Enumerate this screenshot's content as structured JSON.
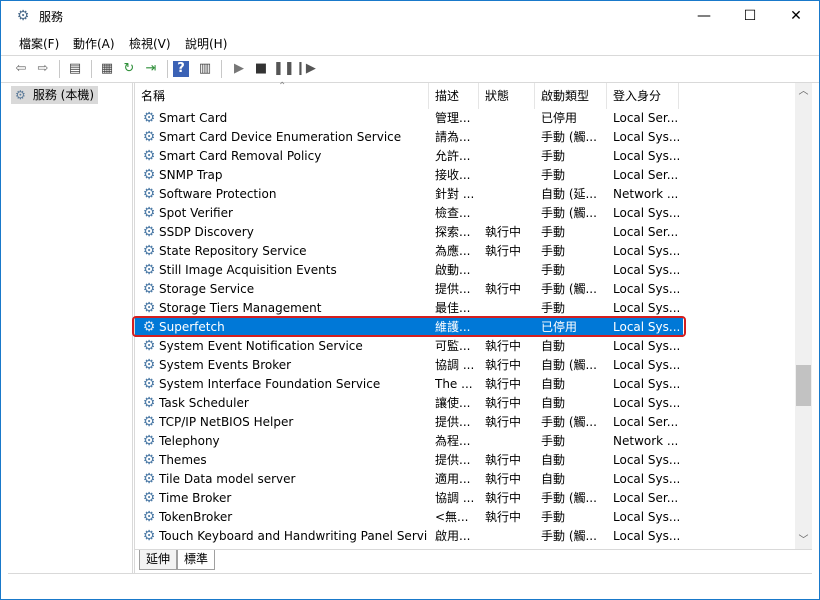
{
  "window": {
    "title": "服務",
    "controls": {
      "minimize": "—",
      "maximize": "☐",
      "close": "✕"
    }
  },
  "menu": [
    {
      "label": "檔案(F)"
    },
    {
      "label": "動作(A)"
    },
    {
      "label": "檢視(V)"
    },
    {
      "label": "說明(H)"
    }
  ],
  "toolbar": {
    "icons": [
      "back-icon",
      "forward-icon",
      "show-console-tree-icon",
      "properties-icon",
      "refresh-icon",
      "export-list-icon",
      "help-icon",
      "view-icon",
      "start-icon",
      "stop-icon",
      "pause-icon",
      "restart-icon"
    ]
  },
  "tree": {
    "item": "服務 (本機)"
  },
  "columns": {
    "name": "名稱",
    "description": "描述",
    "status": "狀態",
    "startup": "啟動類型",
    "logon": "登入身分"
  },
  "services": [
    {
      "name": "Smart Card",
      "description": "管理...",
      "status": "",
      "startup": "已停用",
      "logon": "Local Ser..."
    },
    {
      "name": "Smart Card Device Enumeration Service",
      "description": "請為...",
      "status": "",
      "startup": "手動 (觸...",
      "logon": "Local Sys..."
    },
    {
      "name": "Smart Card Removal Policy",
      "description": "允許...",
      "status": "",
      "startup": "手動",
      "logon": "Local Sys..."
    },
    {
      "name": "SNMP Trap",
      "description": "接收...",
      "status": "",
      "startup": "手動",
      "logon": "Local Ser..."
    },
    {
      "name": "Software Protection",
      "description": "針對 ...",
      "status": "",
      "startup": "自動 (延...",
      "logon": "Network ..."
    },
    {
      "name": "Spot Verifier",
      "description": "檢查...",
      "status": "",
      "startup": "手動 (觸...",
      "logon": "Local Sys..."
    },
    {
      "name": "SSDP Discovery",
      "description": "探索...",
      "status": "執行中",
      "startup": "手動",
      "logon": "Local Ser..."
    },
    {
      "name": "State Repository Service",
      "description": "為應...",
      "status": "執行中",
      "startup": "手動",
      "logon": "Local Sys..."
    },
    {
      "name": "Still Image Acquisition Events",
      "description": "啟動...",
      "status": "",
      "startup": "手動",
      "logon": "Local Sys..."
    },
    {
      "name": "Storage Service",
      "description": "提供...",
      "status": "執行中",
      "startup": "手動 (觸...",
      "logon": "Local Sys..."
    },
    {
      "name": "Storage Tiers Management",
      "description": "最佳...",
      "status": "",
      "startup": "手動",
      "logon": "Local Sys..."
    },
    {
      "name": "Superfetch",
      "description": "維護...",
      "status": "",
      "startup": "已停用",
      "logon": "Local Sys..."
    },
    {
      "name": "System Event Notification Service",
      "description": "可監...",
      "status": "執行中",
      "startup": "自動",
      "logon": "Local Sys..."
    },
    {
      "name": "System Events Broker",
      "description": "協調 ...",
      "status": "執行中",
      "startup": "自動 (觸...",
      "logon": "Local Sys..."
    },
    {
      "name": "System Interface Foundation Service",
      "description": "The ...",
      "status": "執行中",
      "startup": "自動",
      "logon": "Local Sys..."
    },
    {
      "name": "Task Scheduler",
      "description": "讓使...",
      "status": "執行中",
      "startup": "自動",
      "logon": "Local Sys..."
    },
    {
      "name": "TCP/IP NetBIOS Helper",
      "description": "提供...",
      "status": "執行中",
      "startup": "手動 (觸...",
      "logon": "Local Ser..."
    },
    {
      "name": "Telephony",
      "description": "為程...",
      "status": "",
      "startup": "手動",
      "logon": "Network ..."
    },
    {
      "name": "Themes",
      "description": "提供...",
      "status": "執行中",
      "startup": "自動",
      "logon": "Local Sys..."
    },
    {
      "name": "Tile Data model server",
      "description": "適用...",
      "status": "執行中",
      "startup": "自動",
      "logon": "Local Sys..."
    },
    {
      "name": "Time Broker",
      "description": "協調 ...",
      "status": "執行中",
      "startup": "手動 (觸...",
      "logon": "Local Ser..."
    },
    {
      "name": "TokenBroker",
      "description": "<無...",
      "status": "執行中",
      "startup": "手動",
      "logon": "Local Sys..."
    },
    {
      "name": "Touch Keyboard and Handwriting Panel Service",
      "description": "啟用...",
      "status": "",
      "startup": "手動 (觸...",
      "logon": "Local Sys..."
    }
  ],
  "selected_service": "Superfetch",
  "tabs": [
    {
      "label": "延伸"
    },
    {
      "label": "標準"
    }
  ],
  "active_tab": "標準",
  "colors": {
    "selection": "#0078d7",
    "highlight_border": "#d41f1f"
  }
}
